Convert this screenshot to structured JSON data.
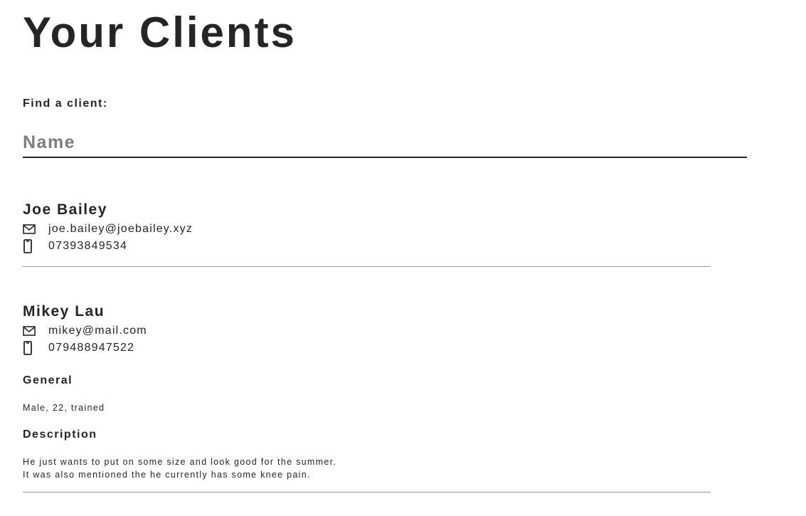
{
  "page": {
    "title": "Your Clients"
  },
  "search": {
    "label": "Find a client:",
    "placeholder": "Name",
    "value": ""
  },
  "clients": [
    {
      "name": "Joe Bailey",
      "email": "joe.bailey@joebailey.xyz",
      "phone": "07393849534",
      "email_icon": "mail-icon",
      "phone_icon": "mobile-phone-icon"
    },
    {
      "name": "Mikey Lau",
      "email": "mikey@mail.com",
      "phone": "079488947522",
      "email_icon": "mail-icon",
      "phone_icon": "mobile-phone-icon",
      "general_heading": "General",
      "general": "Male, 22, trained",
      "description_heading": "Description",
      "description_lines": [
        "He just wants to put on some size and look good for the summer.",
        "It was also mentioned the he currently has some knee pain."
      ]
    }
  ]
}
